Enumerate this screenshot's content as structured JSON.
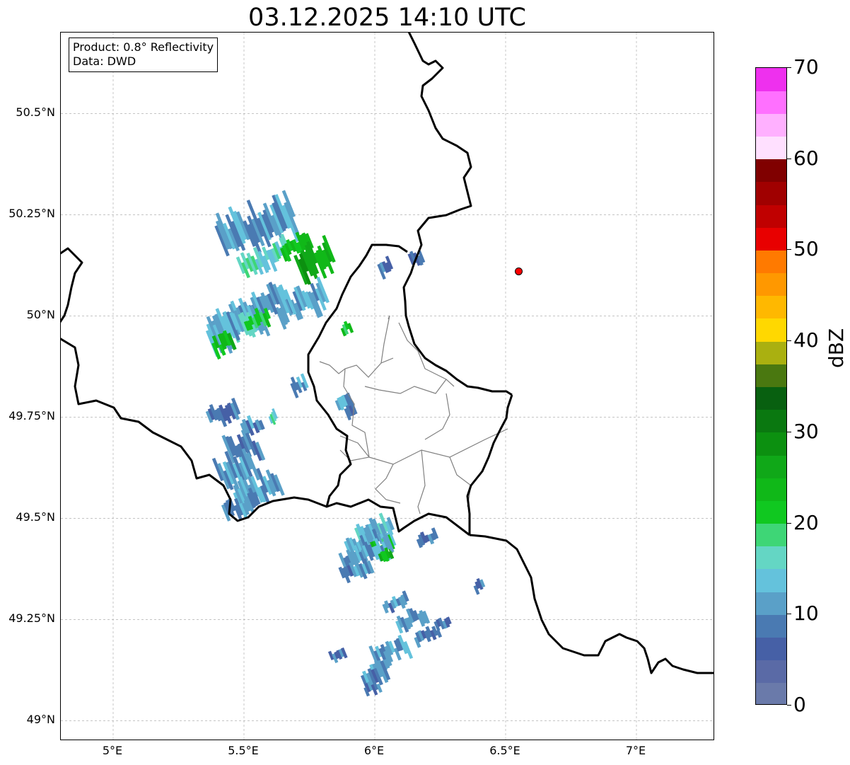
{
  "title": "03.12.2025 14:10 UTC",
  "infobox": {
    "line1": "Product: 0.8° Reflectivity",
    "line2": "Data: DWD"
  },
  "map": {
    "lon_range": [
      4.8,
      7.3
    ],
    "lat_range": [
      48.95,
      50.7
    ],
    "lat_ticks": [
      {
        "value": 50.5,
        "label": "50.5°N"
      },
      {
        "value": 50.25,
        "label": "50.25°N"
      },
      {
        "value": 50.0,
        "label": "50°N"
      },
      {
        "value": 49.75,
        "label": "49.75°N"
      },
      {
        "value": 49.5,
        "label": "49.5°N"
      },
      {
        "value": 49.25,
        "label": "49.25°N"
      },
      {
        "value": 49.0,
        "label": "49°N"
      }
    ],
    "lon_ticks": [
      {
        "value": 5.0,
        "label": "5°E"
      },
      {
        "value": 5.5,
        "label": "5.5°E"
      },
      {
        "value": 6.0,
        "label": "6°E"
      },
      {
        "value": 6.5,
        "label": "6.5°E"
      },
      {
        "value": 7.0,
        "label": "7°E"
      }
    ],
    "marker": {
      "lon": 6.55,
      "lat": 50.11,
      "color": "#ff0000"
    },
    "grid": true
  },
  "colorbar": {
    "unit": "dBZ",
    "min": 0,
    "max": 70,
    "ticks": [
      "0",
      "10",
      "20",
      "30",
      "40",
      "50",
      "60",
      "70"
    ],
    "colors": [
      "#6a7aaa",
      "#5a6aa6",
      "#4660a6",
      "#4a7ab2",
      "#5aa0c8",
      "#64c2dc",
      "#64d6c4",
      "#3ed676",
      "#10c820",
      "#10b818",
      "#10a818",
      "#0c9010",
      "#0a7810",
      "#086010",
      "#4a7810",
      "#aab010",
      "#ffd800",
      "#ffb800",
      "#ff9800",
      "#ff7a00",
      "#e80000",
      "#c00000",
      "#a00000",
      "#800000",
      "#ffe0ff",
      "#ffb0ff",
      "#ff70ff",
      "#ee30ee"
    ]
  },
  "radar_cells": [
    {
      "lon": 5.55,
      "lat": 50.22,
      "w": 0.3,
      "h": 0.1,
      "dbz": 11
    },
    {
      "lon": 5.58,
      "lat": 50.14,
      "w": 0.2,
      "h": 0.06,
      "dbz": 16
    },
    {
      "lon": 5.7,
      "lat": 50.17,
      "w": 0.12,
      "h": 0.05,
      "dbz": 22
    },
    {
      "lon": 5.77,
      "lat": 50.14,
      "w": 0.14,
      "h": 0.08,
      "dbz": 26
    },
    {
      "lon": 5.72,
      "lat": 50.03,
      "w": 0.2,
      "h": 0.07,
      "dbz": 12
    },
    {
      "lon": 5.55,
      "lat": 50.02,
      "w": 0.26,
      "h": 0.07,
      "dbz": 11
    },
    {
      "lon": 5.48,
      "lat": 49.97,
      "w": 0.2,
      "h": 0.08,
      "dbz": 14
    },
    {
      "lon": 5.55,
      "lat": 49.99,
      "w": 0.1,
      "h": 0.04,
      "dbz": 21
    },
    {
      "lon": 5.42,
      "lat": 49.96,
      "w": 0.12,
      "h": 0.08,
      "dbz": 12
    },
    {
      "lon": 5.42,
      "lat": 49.93,
      "w": 0.08,
      "h": 0.05,
      "dbz": 24
    },
    {
      "lon": 5.89,
      "lat": 49.97,
      "w": 0.04,
      "h": 0.03,
      "dbz": 22
    },
    {
      "lon": 5.71,
      "lat": 49.83,
      "w": 0.06,
      "h": 0.04,
      "dbz": 10
    },
    {
      "lon": 5.88,
      "lat": 49.79,
      "w": 0.06,
      "h": 0.04,
      "dbz": 12
    },
    {
      "lon": 5.91,
      "lat": 49.76,
      "w": 0.04,
      "h": 0.04,
      "dbz": 9
    },
    {
      "lon": 5.42,
      "lat": 49.76,
      "w": 0.12,
      "h": 0.05,
      "dbz": 9
    },
    {
      "lon": 5.53,
      "lat": 49.73,
      "w": 0.08,
      "h": 0.04,
      "dbz": 10
    },
    {
      "lon": 5.61,
      "lat": 49.75,
      "w": 0.03,
      "h": 0.03,
      "dbz": 16
    },
    {
      "lon": 5.5,
      "lat": 49.67,
      "w": 0.12,
      "h": 0.08,
      "dbz": 9
    },
    {
      "lon": 5.47,
      "lat": 49.62,
      "w": 0.14,
      "h": 0.08,
      "dbz": 11
    },
    {
      "lon": 5.55,
      "lat": 49.57,
      "w": 0.18,
      "h": 0.07,
      "dbz": 12
    },
    {
      "lon": 5.49,
      "lat": 49.53,
      "w": 0.14,
      "h": 0.05,
      "dbz": 10
    },
    {
      "lon": 6.0,
      "lat": 49.47,
      "w": 0.14,
      "h": 0.05,
      "dbz": 13
    },
    {
      "lon": 5.98,
      "lat": 49.44,
      "w": 0.18,
      "h": 0.05,
      "dbz": 12
    },
    {
      "lon": 6.03,
      "lat": 49.43,
      "w": 0.08,
      "h": 0.04,
      "dbz": 20
    },
    {
      "lon": 5.97,
      "lat": 49.41,
      "w": 0.2,
      "h": 0.05,
      "dbz": 11
    },
    {
      "lon": 6.04,
      "lat": 49.41,
      "w": 0.05,
      "h": 0.03,
      "dbz": 24
    },
    {
      "lon": 6.2,
      "lat": 49.45,
      "w": 0.08,
      "h": 0.03,
      "dbz": 9
    },
    {
      "lon": 5.93,
      "lat": 49.37,
      "w": 0.12,
      "h": 0.04,
      "dbz": 10
    },
    {
      "lon": 6.4,
      "lat": 49.33,
      "w": 0.04,
      "h": 0.03,
      "dbz": 9
    },
    {
      "lon": 6.08,
      "lat": 49.29,
      "w": 0.1,
      "h": 0.03,
      "dbz": 10
    },
    {
      "lon": 6.14,
      "lat": 49.25,
      "w": 0.12,
      "h": 0.04,
      "dbz": 11
    },
    {
      "lon": 6.2,
      "lat": 49.21,
      "w": 0.1,
      "h": 0.03,
      "dbz": 9
    },
    {
      "lon": 6.06,
      "lat": 49.17,
      "w": 0.14,
      "h": 0.05,
      "dbz": 11
    },
    {
      "lon": 6.02,
      "lat": 49.14,
      "w": 0.08,
      "h": 0.04,
      "dbz": 13
    },
    {
      "lon": 6.0,
      "lat": 49.11,
      "w": 0.1,
      "h": 0.05,
      "dbz": 10
    },
    {
      "lon": 5.99,
      "lat": 49.08,
      "w": 0.06,
      "h": 0.03,
      "dbz": 9
    },
    {
      "lon": 5.86,
      "lat": 49.16,
      "w": 0.06,
      "h": 0.03,
      "dbz": 8
    },
    {
      "lon": 6.16,
      "lat": 50.14,
      "w": 0.05,
      "h": 0.04,
      "dbz": 9
    },
    {
      "lon": 6.04,
      "lat": 50.12,
      "w": 0.05,
      "h": 0.04,
      "dbz": 8
    },
    {
      "lon": 6.26,
      "lat": 49.24,
      "w": 0.06,
      "h": 0.03,
      "dbz": 8
    }
  ]
}
